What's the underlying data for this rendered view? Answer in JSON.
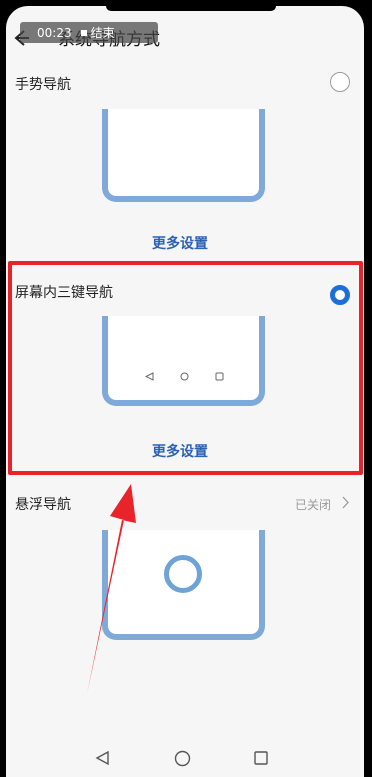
{
  "recording": {
    "time": "00:23",
    "end_label": "结束"
  },
  "header": {
    "back_icon": "back-arrow-icon",
    "title": "系统导航方式"
  },
  "options": [
    {
      "label": "手势导航",
      "more": "更多设置",
      "selected": false
    },
    {
      "label": "屏幕内三键导航",
      "more": "更多设置",
      "selected": true
    },
    {
      "label": "悬浮导航",
      "status": "已关闭",
      "selected": false
    }
  ],
  "colors": {
    "accent": "#1e6ed8",
    "illustration": "#7ea9d8",
    "highlight": "#e8232a",
    "link": "#2b62b4"
  },
  "icons": [
    "radio-off-icon",
    "radio-on-icon",
    "triangle-back-icon",
    "circle-home-icon",
    "square-recent-icon",
    "chevron-right-icon",
    "red-arrow-annotation"
  ]
}
